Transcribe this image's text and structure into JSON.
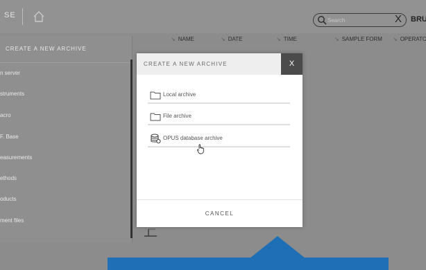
{
  "topbar": {
    "app_fragment": "SE",
    "search_placeholder": "Search",
    "clear_label": "X",
    "brand_fragment": "BRU"
  },
  "columns": [
    {
      "label": "NAME"
    },
    {
      "label": "DATE"
    },
    {
      "label": "TIME"
    },
    {
      "label": "SAMPLE FORM"
    },
    {
      "label": "OPERATO"
    }
  ],
  "sidebar": {
    "heading": "CREATE A NEW ARCHIVE",
    "items": [
      {
        "label": "n server"
      },
      {
        "label": "struments"
      },
      {
        "label": "acro"
      },
      {
        "label": "F. Base"
      },
      {
        "label": "easurements"
      },
      {
        "label": "ethods"
      },
      {
        "label": "oducts"
      },
      {
        "label": "ment files"
      }
    ]
  },
  "modal": {
    "title": "CREATE A NEW ARCHIVE",
    "close_label": "X",
    "options": [
      {
        "label": "Local archive",
        "icon": "folder-icon"
      },
      {
        "label": "File archive",
        "icon": "folder-icon"
      },
      {
        "label": "OPUS database archive",
        "icon": "database-icon"
      }
    ],
    "cancel_label": "CANCEL"
  },
  "colors": {
    "overlay_gray": "#8c8c8c",
    "modal_header": "#eeeeee",
    "close_button": "#4b4b4b",
    "highlight_blue": "#1e6fb5"
  }
}
